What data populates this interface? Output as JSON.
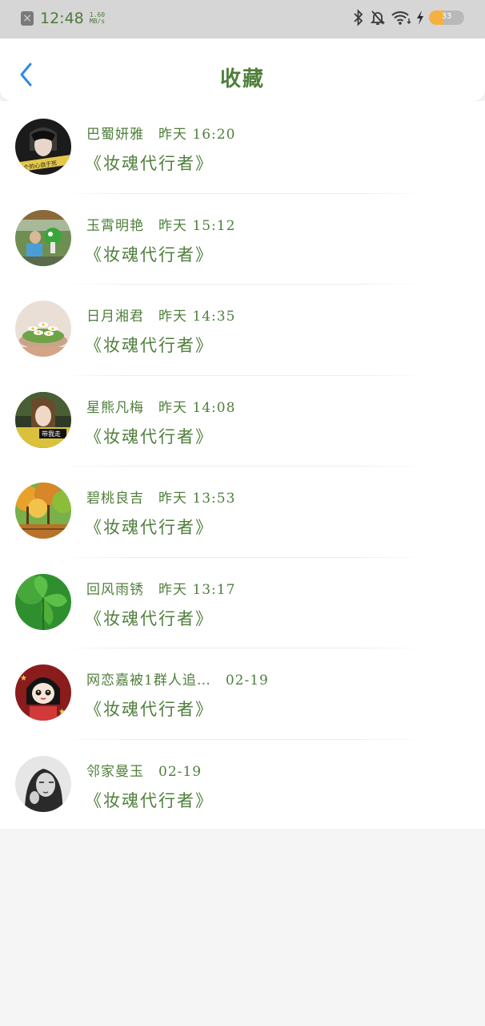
{
  "status_bar": {
    "time": "12:48",
    "speed_value": "1.60",
    "speed_unit": "MB/s",
    "battery_level": "33",
    "battery_fraction": 0.4,
    "icons": [
      "close-notification-icon",
      "bluetooth-icon",
      "bell-muted-icon",
      "wifi-icon",
      "charging-icon",
      "battery-icon"
    ]
  },
  "header": {
    "title": "收藏",
    "back_icon": "chevron-left-icon"
  },
  "colors": {
    "accent_green": "#4f7f3b",
    "back_blue": "#2b8be6",
    "status_bar_bg": "#d6d6d6",
    "page_bg": "#f6f5f6"
  },
  "favorites": [
    {
      "user": "巴蜀妍雅",
      "time": "昨天 16:20",
      "book": "《妆魂代行者》",
      "avatar": "avatar-girl-dark"
    },
    {
      "user": "玉霄明艳",
      "time": "昨天 15:12",
      "book": "《妆魂代行者》",
      "avatar": "avatar-child-outdoor"
    },
    {
      "user": "日月湘君",
      "time": "昨天 14:35",
      "book": "《妆魂代行者》",
      "avatar": "avatar-white-flowers"
    },
    {
      "user": "星熊凡梅",
      "time": "昨天 14:08",
      "book": "《妆魂代行者》",
      "avatar": "avatar-girl-yellow"
    },
    {
      "user": "碧桃良吉",
      "time": "昨天 13:53",
      "book": "《妆魂代行者》",
      "avatar": "avatar-autumn-trees"
    },
    {
      "user": "回风雨锈",
      "time": "昨天 13:17",
      "book": "《妆魂代行者》",
      "avatar": "avatar-green-leaf"
    },
    {
      "user": "网恋嘉被1群人追…",
      "time": "02-19",
      "book": "《妆魂代行者》",
      "avatar": "avatar-anime-red"
    },
    {
      "user": "邻家曼玉",
      "time": "02-19",
      "book": "《妆魂代行者》",
      "avatar": "avatar-woman-bw"
    }
  ]
}
